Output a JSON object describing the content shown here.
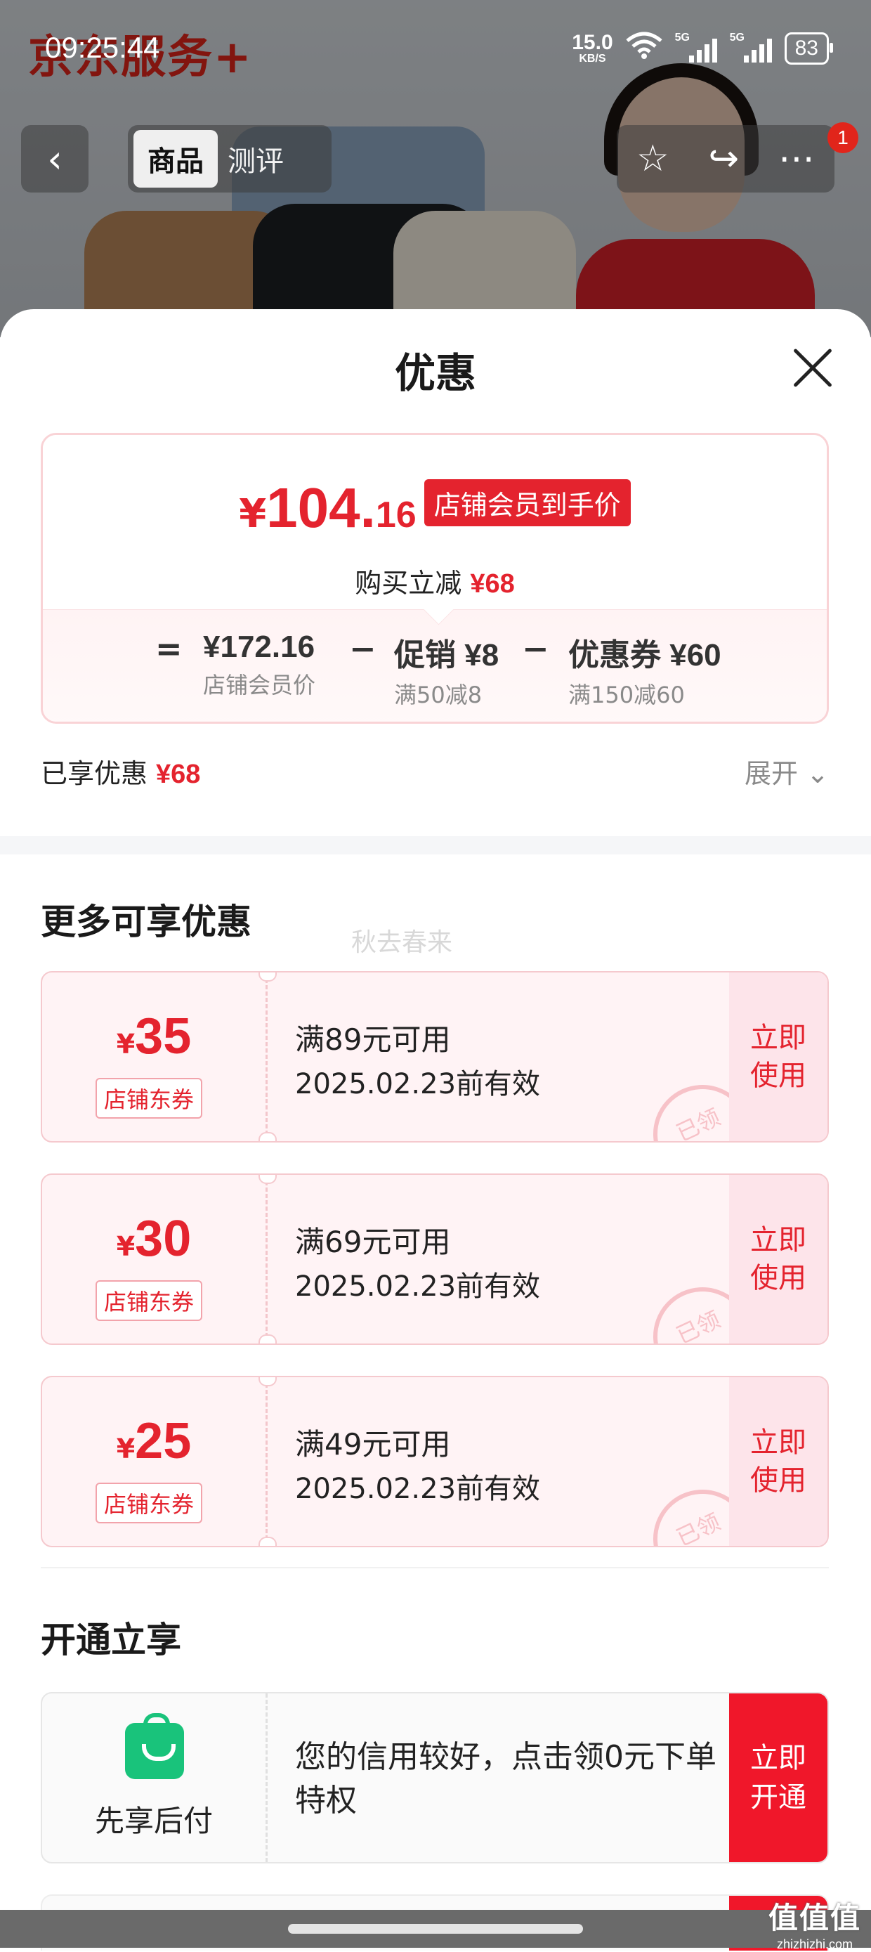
{
  "status_bar": {
    "time": "09:25:44",
    "net_speed": "15.0",
    "net_unit": "KB/S",
    "signal1": "5G",
    "signal2": "5G",
    "battery": "83"
  },
  "background": {
    "brand_text": "京东服务+"
  },
  "nav": {
    "tab_active": "商品",
    "tab_review": "测评",
    "badge": "1"
  },
  "sheet": {
    "title": "优惠",
    "price": {
      "currency": "¥",
      "integer": "104.",
      "decimal": "16",
      "tag": "店铺会员到手价",
      "sub_label": "购买立减",
      "sub_amount": "¥68"
    },
    "calc": {
      "equals": "=",
      "base_value": "¥172.16",
      "base_label": "店铺会员价",
      "minus": "−",
      "promo_value": "促销 ¥8",
      "promo_label": "满50减8",
      "coupon_value": "优惠券 ¥60",
      "coupon_label": "满150减60"
    },
    "enjoyed_label": "已享优惠",
    "enjoyed_amount": "¥68",
    "expand_label": "展开",
    "more_title": "更多可享优惠",
    "watermark": "秋去春来",
    "coupons": [
      {
        "yen": "¥",
        "amount": "35",
        "type": "店铺东券",
        "condition": "满89元可用",
        "valid": "2025.02.23前有效",
        "action": "立即使用",
        "stamp": "已领"
      },
      {
        "yen": "¥",
        "amount": "30",
        "type": "店铺东券",
        "condition": "满69元可用",
        "valid": "2025.02.23前有效",
        "action": "立即使用",
        "stamp": "已领"
      },
      {
        "yen": "¥",
        "amount": "25",
        "type": "店铺东券",
        "condition": "满49元可用",
        "valid": "2025.02.23前有效",
        "action": "立即使用",
        "stamp": "已领"
      }
    ],
    "open_title": "开通立享",
    "pay_later": {
      "name": "先享后付",
      "desc": "您的信用较好，点击领0元下单特权",
      "action": "立即开通"
    }
  },
  "site_watermark": {
    "big": "值值值",
    "small": "zhizhizhi.com"
  },
  "colors": {
    "accent_red": "#e4232e",
    "pay_green": "#19c37b",
    "cta_red": "#f0172a"
  }
}
